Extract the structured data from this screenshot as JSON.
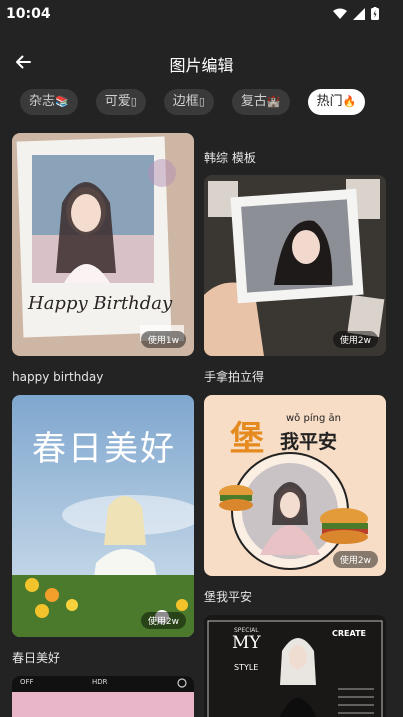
{
  "status": {
    "time": "10:04"
  },
  "header": {
    "title": "图片编辑"
  },
  "tabs": [
    {
      "label": "杂志",
      "emoji": "📚"
    },
    {
      "label": "可爱",
      "emoji": "▯"
    },
    {
      "label": "边框",
      "emoji": "▯"
    },
    {
      "label": "复古",
      "emoji": "🏰"
    },
    {
      "label": "热门",
      "emoji": "🔥"
    }
  ],
  "templates": [
    {
      "title": "happy birthday",
      "usage": "使用1w",
      "overlay": "Happy Birthday"
    },
    {
      "title": "韩综 模板",
      "usage": ""
    },
    {
      "title": "手拿拍立得",
      "usage": "使用2w"
    },
    {
      "title": "春日美好",
      "usage": "使用2w",
      "overlay": "春日美好"
    },
    {
      "title": "堡我平安",
      "usage": "使用2w",
      "overlay_big": "堡",
      "overlay": "我平安",
      "pinyin": "wǒ píng ān"
    },
    {
      "title": "",
      "overlay_top": "SPECIAL",
      "overlay": "MY",
      "overlay_mid": "STYLE",
      "overlay_right": "CREATE"
    },
    {
      "title": "",
      "overlay_left": "OFF",
      "overlay": "HDR"
    }
  ],
  "colors": {
    "background": "#232323",
    "active_tab": "#ffffff",
    "tab": "#3a3a3a"
  }
}
